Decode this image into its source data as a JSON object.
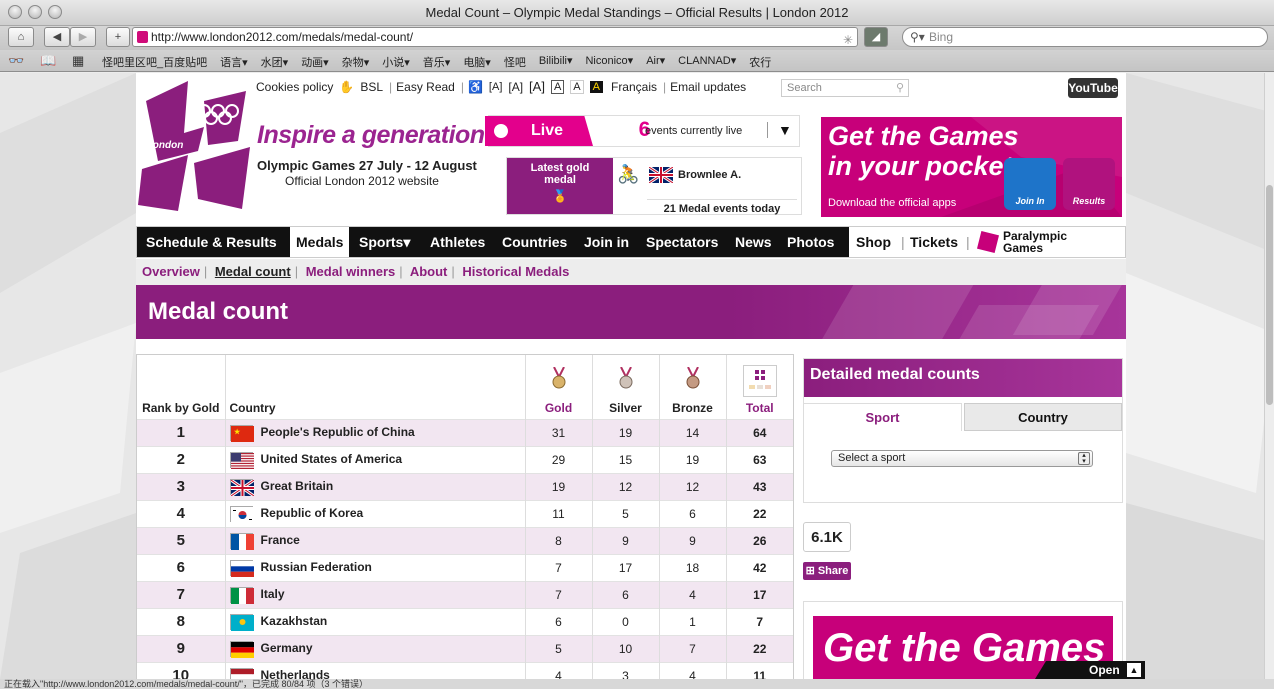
{
  "window": {
    "title": "Medal Count – Olympic Medal Standings – Official Results | London 2012"
  },
  "toolbar": {
    "url": "http://www.london2012.com/medals/medal-count/",
    "search_placeholder": "Bing"
  },
  "bookmarks": [
    "怪吧里区吧_百度贴吧",
    "语言▾",
    "水团▾",
    "动画▾",
    "杂物▾",
    "小说▾",
    "音乐▾",
    "电脑▾",
    "怪吧",
    "Bilibili▾",
    "Niconico▾",
    "Air▾",
    "CLANNAD▾",
    "农行"
  ],
  "status_text": "正在载入\"http://www.london2012.com/medals/medal-count/\"，已完成 80/84 项（3 个错误）",
  "utility": {
    "cookies": "Cookies policy",
    "bsl": "BSL",
    "easy_read": "Easy Read",
    "size_small": "[A]",
    "size_medium": "[A]",
    "size_large": "[A]",
    "contrast1": "A",
    "contrast2": "A",
    "contrast3": "A",
    "francais": "Français",
    "email": "Email updates",
    "search_placeholder": "Search",
    "youtube": "YouTube"
  },
  "header": {
    "logo_text": "london",
    "tagline": "Inspire a generation",
    "dates": "Olympic Games 27 July - 12 August",
    "official": "Official London 2012 website"
  },
  "live": {
    "label": "Live",
    "count": "6",
    "text": "events currently live"
  },
  "latest": {
    "label": "Latest gold medal",
    "athlete": "Brownlee A.",
    "today": "21 Medal events today"
  },
  "promo": {
    "title": "Get the Games in your pocket",
    "subtitle": "Download the official apps",
    "app1": "Join In",
    "app2": "Results"
  },
  "nav": {
    "items": [
      "Schedule & Results",
      "Medals",
      "Sports▾",
      "Athletes",
      "Countries",
      "Join in",
      "Spectators",
      "News",
      "Photos"
    ],
    "shop": "Shop",
    "tickets": "Tickets",
    "paralympic": "Paralympic Games"
  },
  "subnav": {
    "overview": "Overview",
    "medal_count": "Medal count",
    "medal_winners": "Medal winners",
    "about": "About",
    "historical": "Historical Medals"
  },
  "page_title": "Medal count",
  "table": {
    "headers": {
      "rank": "Rank by Gold",
      "country": "Country",
      "gold": "Gold",
      "silver": "Silver",
      "bronze": "Bronze",
      "total": "Total"
    },
    "rows": [
      {
        "rank": "1",
        "country": "People's Republic of China",
        "gold": "31",
        "silver": "19",
        "bronze": "14",
        "total": "64",
        "flag": "cn"
      },
      {
        "rank": "2",
        "country": "United States of America",
        "gold": "29",
        "silver": "15",
        "bronze": "19",
        "total": "63",
        "flag": "us"
      },
      {
        "rank": "3",
        "country": "Great Britain",
        "gold": "19",
        "silver": "12",
        "bronze": "12",
        "total": "43",
        "flag": "gb"
      },
      {
        "rank": "4",
        "country": "Republic of Korea",
        "gold": "11",
        "silver": "5",
        "bronze": "6",
        "total": "22",
        "flag": "kr"
      },
      {
        "rank": "5",
        "country": "France",
        "gold": "8",
        "silver": "9",
        "bronze": "9",
        "total": "26",
        "flag": "fr"
      },
      {
        "rank": "6",
        "country": "Russian Federation",
        "gold": "7",
        "silver": "17",
        "bronze": "18",
        "total": "42",
        "flag": "ru"
      },
      {
        "rank": "7",
        "country": "Italy",
        "gold": "7",
        "silver": "6",
        "bronze": "4",
        "total": "17",
        "flag": "it"
      },
      {
        "rank": "8",
        "country": "Kazakhstan",
        "gold": "6",
        "silver": "0",
        "bronze": "1",
        "total": "7",
        "flag": "kz"
      },
      {
        "rank": "9",
        "country": "Germany",
        "gold": "5",
        "silver": "10",
        "bronze": "7",
        "total": "22",
        "flag": "de"
      },
      {
        "rank": "10",
        "country": "Netherlands",
        "gold": "4",
        "silver": "3",
        "bronze": "4",
        "total": "11",
        "flag": "nl"
      }
    ]
  },
  "sidebar": {
    "title": "Detailed medal counts",
    "tab_sport": "Sport",
    "tab_country": "Country",
    "select_value": "Select a sport"
  },
  "share": {
    "count": "6.1K",
    "label": "Share"
  },
  "promo2": {
    "title": "Get the Games"
  },
  "open_bar": "Open",
  "colors": {
    "brand_purple": "#8b1e7d",
    "brand_pink": "#e3008c"
  }
}
